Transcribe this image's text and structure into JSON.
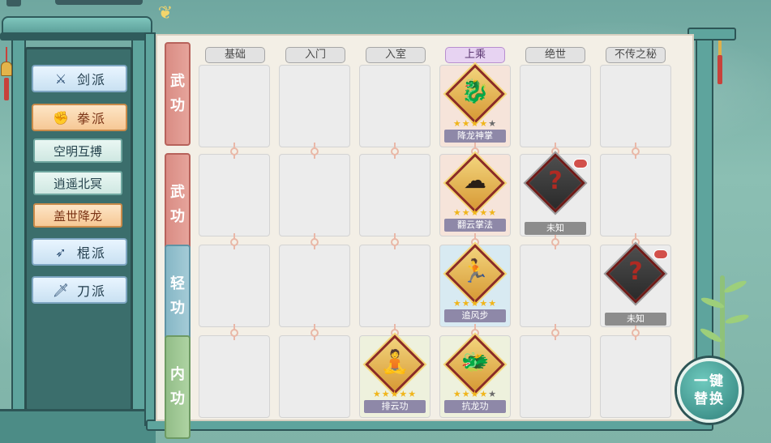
{
  "sidebar": {
    "schools": [
      {
        "label": "剑派",
        "icon": "sword-icon",
        "active": false
      },
      {
        "label": "拳派",
        "icon": "fist-icon",
        "active": true
      },
      {
        "label": "棍派",
        "icon": "staff-icon",
        "active": false
      },
      {
        "label": "刀派",
        "icon": "blade-icon",
        "active": false
      }
    ],
    "subitems": [
      {
        "label": "空明互搏",
        "active": false
      },
      {
        "label": "逍遥北冥",
        "active": false
      },
      {
        "label": "盖世降龙",
        "active": true
      }
    ]
  },
  "columns": [
    "基础",
    "入门",
    "入室",
    "上乘",
    "绝世",
    "不传之秘"
  ],
  "active_column": "上乘",
  "rows": [
    {
      "label_top": "武",
      "label_bottom": "功"
    },
    {
      "label_top": "武",
      "label_bottom": "功"
    },
    {
      "label_top": "轻",
      "label_bottom": "功"
    },
    {
      "label_top": "内",
      "label_bottom": "功"
    }
  ],
  "skills": {
    "xianglong": {
      "name": "降龙神掌",
      "stars": 4,
      "max_stars": 5,
      "icon": "dragon-palm-icon"
    },
    "fanyun": {
      "name": "翻云掌法",
      "stars": 5,
      "max_stars": 5,
      "icon": "cloud-palm-icon"
    },
    "unknown1": {
      "name": "未知",
      "icon": "question-mark-icon"
    },
    "zhuifeng": {
      "name": "追风步",
      "stars": 5,
      "max_stars": 5,
      "icon": "wind-step-icon"
    },
    "unknown2": {
      "name": "未知",
      "icon": "question-mark-icon"
    },
    "paiyun": {
      "name": "排云功",
      "stars": 5,
      "max_stars": 5,
      "icon": "meditation-icon"
    },
    "kanglong": {
      "name": "抗龙功",
      "stars": 4,
      "max_stars": 5,
      "icon": "dragon-guard-icon"
    }
  },
  "action_button": {
    "line1": "一键",
    "line2": "替换"
  },
  "colors": {
    "accent_purple": "#e7d3f2",
    "wugong_label": "#d98c84",
    "qinggong_label": "#86b7c6",
    "neigong_label": "#92bd88",
    "star": "#f0b51b"
  }
}
